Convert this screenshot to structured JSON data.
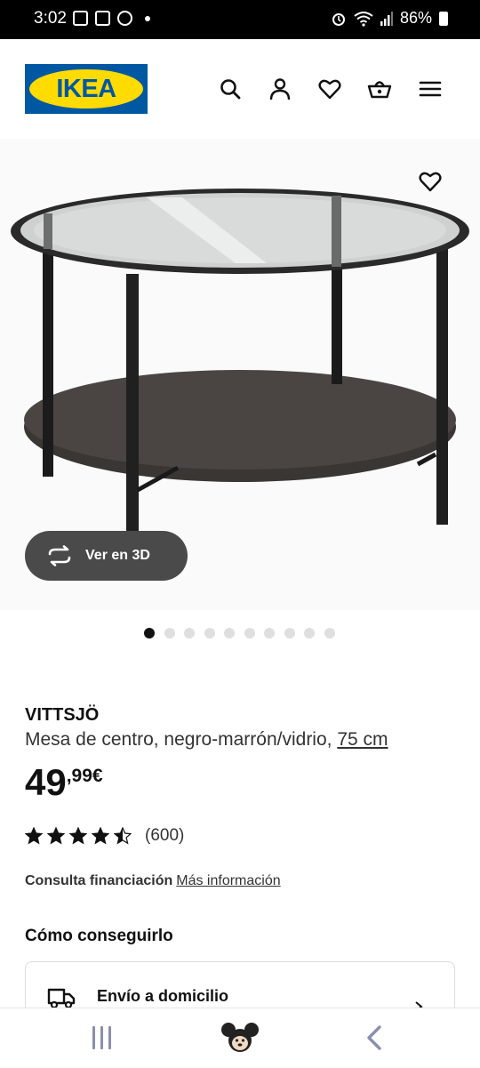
{
  "status_bar": {
    "time": "3:02",
    "battery": "86%",
    "left_icons": [
      "gallery-icon",
      "bag-icon",
      "chrome-icon",
      "dot-icon"
    ],
    "right_icons": [
      "alarm-icon",
      "wifi-icon",
      "signal-icon",
      "battery-icon"
    ]
  },
  "header": {
    "logo_text": "IKEA",
    "icons": [
      "search-icon",
      "account-icon",
      "heart-icon",
      "basket-icon",
      "menu-icon"
    ],
    "colors": {
      "logo_blue": "#0058a3",
      "logo_yellow": "#ffdb00"
    }
  },
  "gallery": {
    "view_3d_label": "Ver en 3D",
    "image_count": 10,
    "active_index": 0
  },
  "product": {
    "name": "VITTSJÖ",
    "description": "Mesa de centro, negro-marrón/vidrio,",
    "size_link": "75 cm",
    "price_integer": "49",
    "price_decimal": ",99€",
    "rating_stars": 4.5,
    "rating_count": "(600)"
  },
  "financing": {
    "label": "Consulta financiación",
    "link": "Más información"
  },
  "delivery": {
    "section_title": "Cómo conseguirlo",
    "option_title": "Envío a domicilio"
  },
  "nav_bar": {
    "icons": [
      "recent-apps-icon",
      "home-icon",
      "back-icon"
    ]
  }
}
